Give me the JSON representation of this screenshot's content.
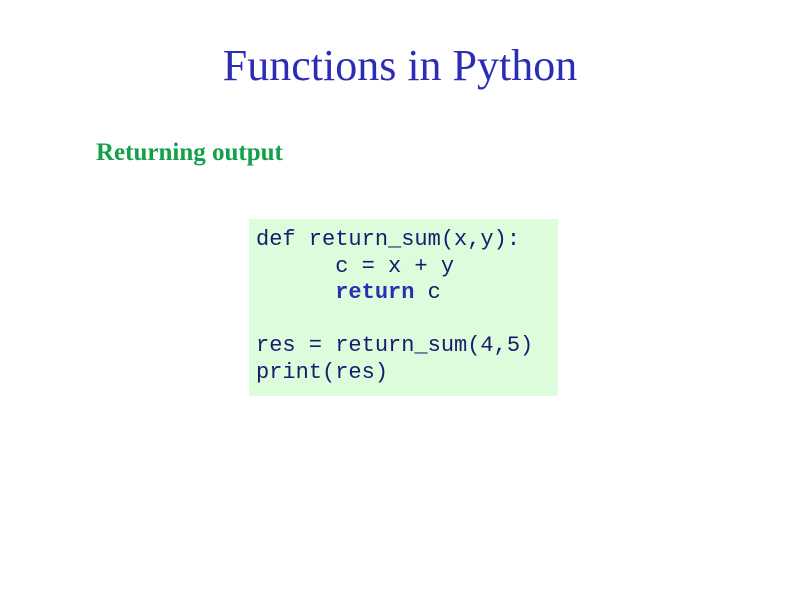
{
  "slide": {
    "title": "Functions in Python",
    "subtitle": "Returning output"
  },
  "code": {
    "line1": "def return_sum(x,y):",
    "line2_indent": "      ",
    "line2": "c = x + y",
    "line3_indent": "      ",
    "line3_keyword": "return",
    "line3_rest": " c",
    "line4": "",
    "line5": "res = return_sum(4,5)",
    "line6": "print(res)"
  },
  "colors": {
    "title": "#2d2db4",
    "subtitle": "#12a04a",
    "code_background": "#ddfcdc",
    "code_text": "#1a1a6e"
  }
}
